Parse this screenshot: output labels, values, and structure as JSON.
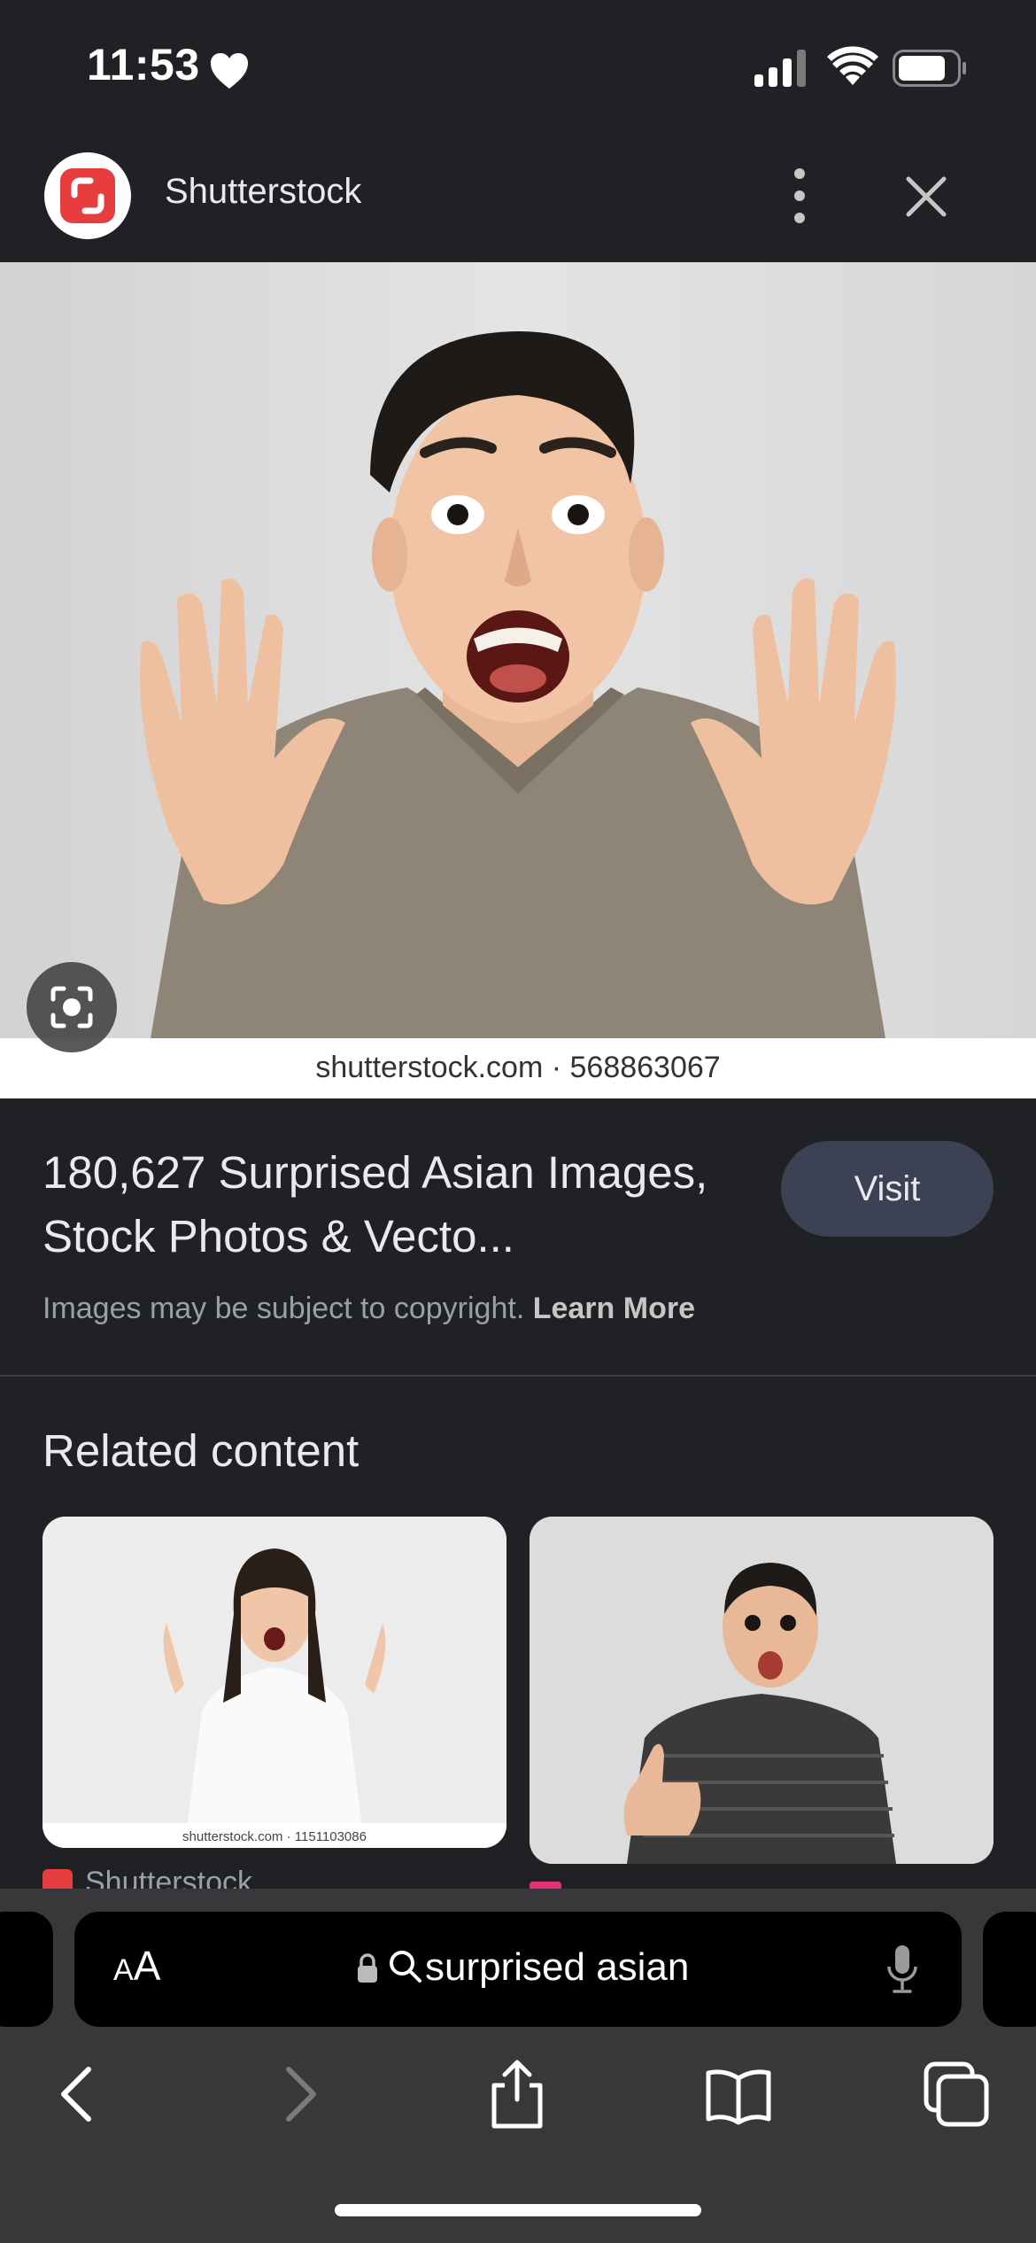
{
  "status_bar": {
    "time": "11:53",
    "icons": [
      "heart-icon",
      "cellular-signal-icon",
      "wifi-icon",
      "battery-icon"
    ]
  },
  "header": {
    "site_name": "Shutterstock",
    "logo_color": "#e63e3e",
    "icons": [
      "more-vertical-icon",
      "close-icon"
    ]
  },
  "main_image": {
    "watermark": "shutterstock.com · 568863067",
    "lens_icon": "lens-icon"
  },
  "result": {
    "title": "180,627 Surprised Asian Images, Stock Photos & Vecto...",
    "visit_label": "Visit",
    "copyright_text": "Images may be subject to copyright.",
    "learn_more": "Learn More"
  },
  "related": {
    "heading": "Related content",
    "cards": [
      {
        "watermark": "shutterstock.com · 1151103086",
        "source": "Shutterstock"
      },
      {
        "watermark": "",
        "source": ""
      }
    ]
  },
  "url_bar": {
    "aa_label_small": "A",
    "aa_label_large": "A",
    "query": "surprised asian"
  },
  "toolbar": {
    "icons": [
      "back-icon",
      "forward-icon",
      "share-icon",
      "bookmarks-icon",
      "tabs-icon"
    ]
  },
  "colors": {
    "background": "#202124",
    "chrome": "#38383a",
    "visit_button": "#3c4253",
    "brand": "#e63e3e"
  }
}
